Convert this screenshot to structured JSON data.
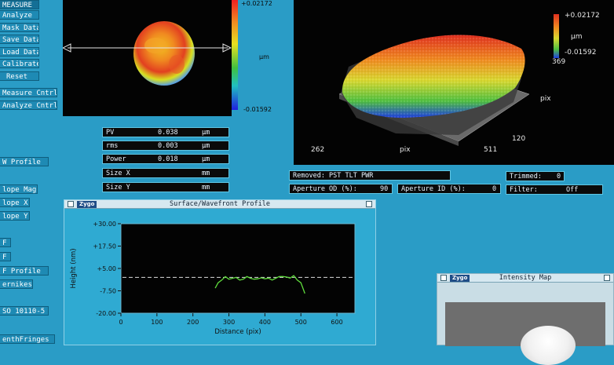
{
  "menu": {
    "buttons": [
      "MEASURE",
      "Analyze",
      "Mask Data",
      "Save Data",
      "Load Data",
      "Calibrate",
      "Reset"
    ],
    "controls": [
      "Measure Cntrl",
      "Analyze Cntrl"
    ],
    "lower": [
      "W Profile",
      "lope Mag",
      "lope X",
      "lope Y",
      "F",
      "F",
      "F Profile",
      "ernikes",
      "SO 10110-5",
      "enthFringes"
    ]
  },
  "scale_2d": {
    "max": "+0.02172",
    "unit": "μm",
    "min": "-0.01592"
  },
  "scale_3d": {
    "max": "+0.02172",
    "unit": "μm",
    "min": "-0.01592"
  },
  "axes_3d": {
    "y_top": "369",
    "y_label": "pix",
    "y_bottom": "120",
    "x_left": "262",
    "x_label": "pix",
    "x_right": "511"
  },
  "results": [
    {
      "label": "PV",
      "value": "0.038",
      "unit": "μm"
    },
    {
      "label": "rms",
      "value": "0.003",
      "unit": "μm"
    },
    {
      "label": "Power",
      "value": "0.018",
      "unit": "μm"
    },
    {
      "label": "Size X",
      "value": "",
      "unit": "mm"
    },
    {
      "label": "Size Y",
      "value": "",
      "unit": "mm"
    }
  ],
  "info": {
    "removed": "Removed: PST TLT PWR",
    "trimmed_label": "Trimmed:",
    "trimmed_value": "0",
    "ap_od_label": "Aperture OD (%):",
    "ap_od_value": "90",
    "ap_id_label": "Aperture ID (%):",
    "ap_id_value": "0",
    "filter_label": "Filter:",
    "filter_value": "Off"
  },
  "profile_window": {
    "logo": "Zygo",
    "title": "Surface/Wavefront Profile"
  },
  "intensity_window": {
    "logo": "Zygo",
    "title": "Intensity Map"
  },
  "colors": {
    "background": "#2a9cc6",
    "trace": "#5fdc3c"
  },
  "chart_data": {
    "type": "line",
    "title": "",
    "xlabel": "Distance (pix)",
    "ylabel": "Height (nm)",
    "xlim": [
      0,
      650
    ],
    "ylim": [
      -20,
      30
    ],
    "x_ticks": [
      "0",
      "100",
      "200",
      "300",
      "400",
      "500",
      "600"
    ],
    "y_ticks": [
      "+30.00",
      "+17.50",
      "+5.00",
      "-7.50",
      "-20.00"
    ],
    "reference_line_y": 0,
    "series": [
      {
        "x": [
          262,
          270,
          280,
          290,
          300,
          310,
          320,
          330,
          340,
          350,
          360,
          370,
          380,
          390,
          400,
          410,
          420,
          430,
          440,
          450,
          460,
          470,
          480,
          490,
          500,
          511
        ],
        "y": [
          -6,
          -3,
          -1.5,
          0.5,
          -1,
          -0.5,
          0,
          -1.5,
          -1,
          0.5,
          -0.5,
          -1,
          -0.8,
          -0.2,
          -0.8,
          -0.4,
          -1.5,
          -0.5,
          0.5,
          0.5,
          0.2,
          -0.4,
          1,
          -1.5,
          -3,
          -9
        ]
      }
    ]
  }
}
